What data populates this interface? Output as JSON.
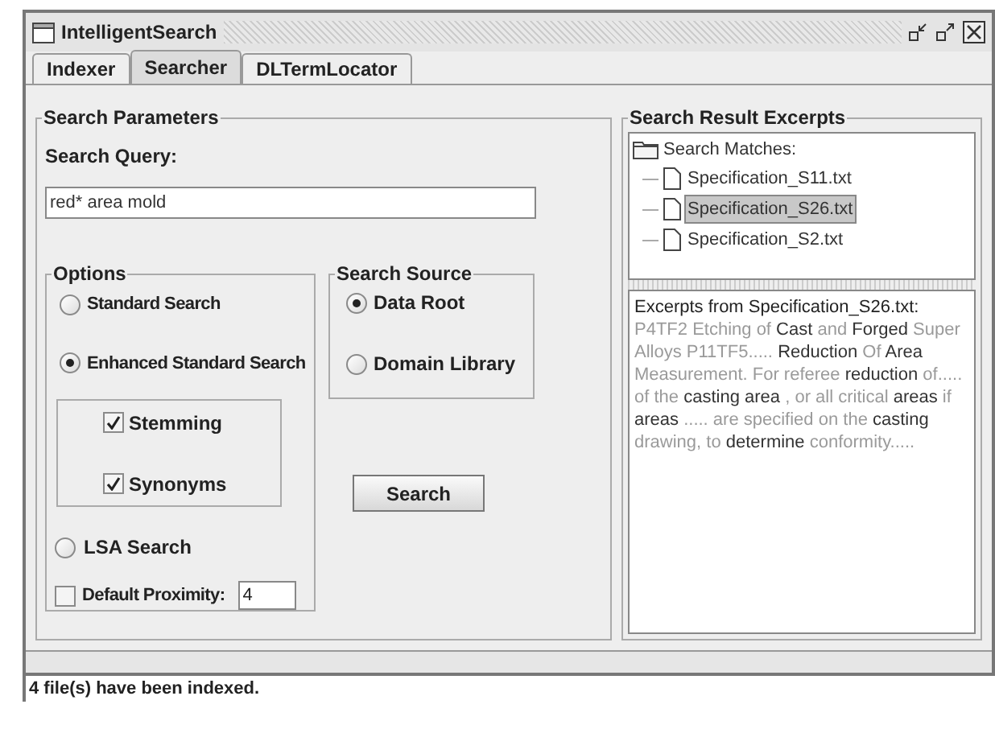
{
  "window": {
    "title": "IntelligentSearch"
  },
  "tabs": [
    {
      "label": "Indexer",
      "selected": false
    },
    {
      "label": "Searcher",
      "selected": true
    },
    {
      "label": "DLTermLocator",
      "selected": false
    }
  ],
  "search_parameters": {
    "title": "Search Parameters",
    "query_label": "Search Query:",
    "query": "red* area mold",
    "options": {
      "title": "Options",
      "modes": [
        {
          "label": "Standard Search",
          "selected": false
        },
        {
          "label": "Enhanced Standard Search",
          "selected": true
        }
      ],
      "enhancements": [
        {
          "label": "Stemming",
          "checked": true
        },
        {
          "label": "Synonyms",
          "checked": true
        }
      ],
      "lsa": {
        "label": "LSA Search",
        "selected": false
      },
      "proximity": {
        "label": "Default Proximity:",
        "checked": false,
        "value": "4"
      }
    },
    "source": {
      "title": "Search Source",
      "items": [
        {
          "label": "Data Root",
          "selected": true
        },
        {
          "label": "Domain Library",
          "selected": false
        }
      ]
    },
    "search_button": "Search"
  },
  "results": {
    "title": "Search Result Excerpts",
    "root": "Search Matches:",
    "files": [
      {
        "label": "Specification_S11.txt",
        "selected": false
      },
      {
        "label": "Specification_S26.txt",
        "selected": true
      },
      {
        "label": "Specification_S2.txt",
        "selected": false
      }
    ],
    "excerpt_heading": "Excerpts from Specification_S26.txt:",
    "excerpt": "P4TF2 Etching of **Cast** and **Forged** Super Alloys  P11TF5..... **Reduction** Of **Area** Measurement. For referee **reduction** of..... of the **casting** **area** , or all critical **areas** if **areas** ..... are specified on the **casting** drawing, to **determine** conformity....."
  },
  "status_bar": "4 file(s) have been indexed."
}
